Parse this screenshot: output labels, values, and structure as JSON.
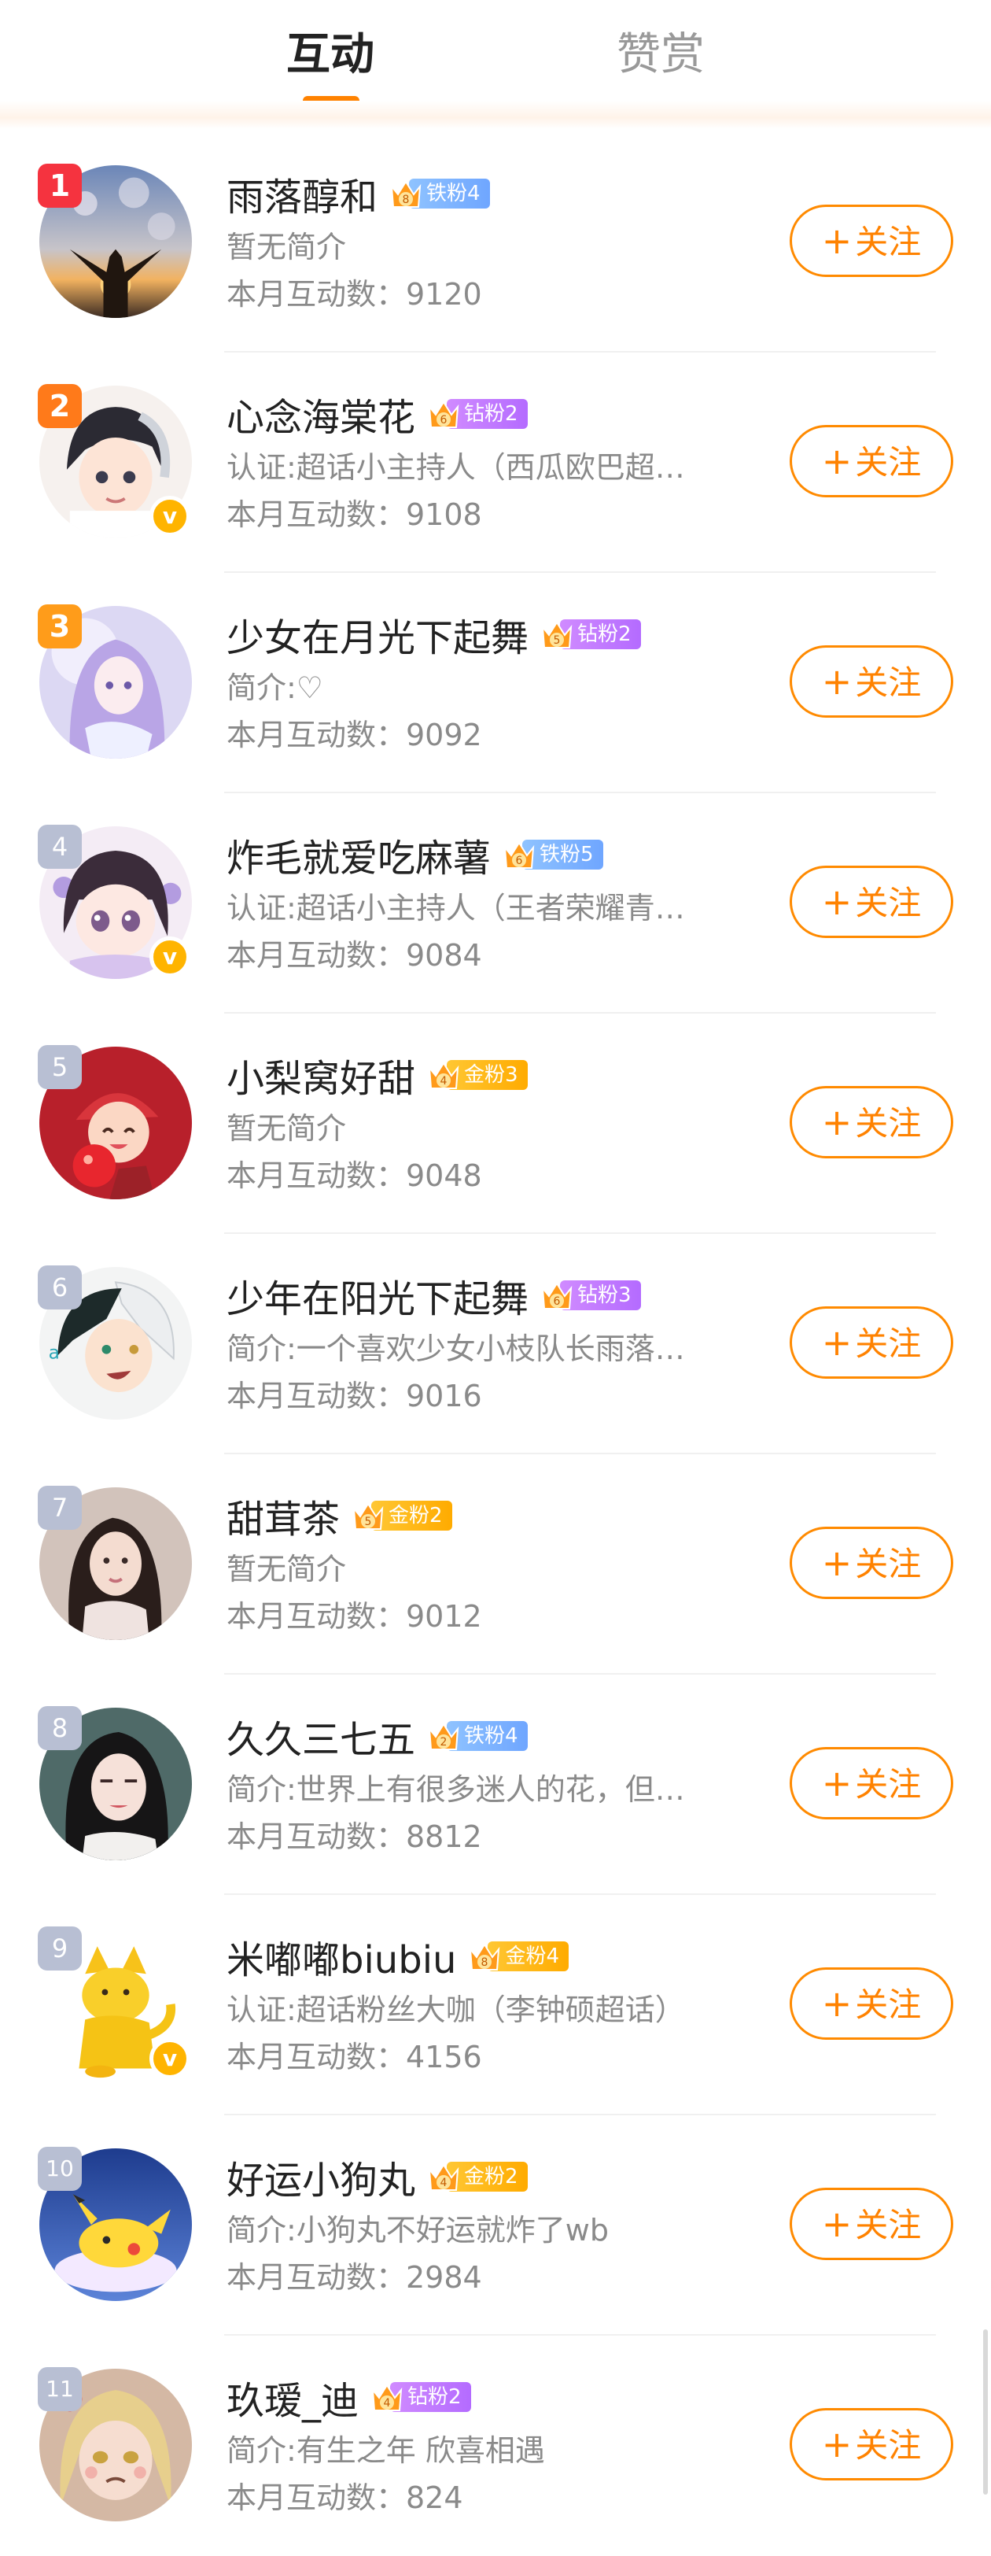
{
  "tabs": {
    "active": "互动",
    "other": "赞赏"
  },
  "colors": {
    "accent": "#ff8200",
    "iron": "#6fa6ff",
    "diamond": "#b46bff",
    "gold": "#ffab00"
  },
  "follow_label": "关注",
  "follow_icon": "plus-icon",
  "rows": [
    {
      "rank": "1",
      "name": "雨落醇和",
      "crown": "8",
      "fan_label": "铁粉4",
      "fan_type": "iron",
      "desc": "暂无简介",
      "count_label": "本月互动数：9120",
      "verified": false,
      "avatar": "sunset-person"
    },
    {
      "rank": "2",
      "name": "心念海棠花",
      "crown": "6",
      "fan_label": "钻粉2",
      "fan_type": "diamond",
      "desc": "认证:超话小主持人（西瓜欧巴超…",
      "count_label": "本月互动数：9108",
      "verified": true,
      "avatar": "anime-boy"
    },
    {
      "rank": "3",
      "name": "少女在月光下起舞",
      "crown": "5",
      "fan_label": "钻粉2",
      "fan_type": "diamond",
      "desc": "简介:♡",
      "count_label": "本月互动数：9092",
      "verified": false,
      "avatar": "anime-girl-purple"
    },
    {
      "rank": "4",
      "name": "炸毛就爱吃麻薯",
      "crown": "6",
      "fan_label": "铁粉5",
      "fan_type": "iron",
      "desc": "认证:超话小主持人（王者荣耀青…",
      "count_label": "本月互动数：9084",
      "verified": true,
      "avatar": "chibi-girl"
    },
    {
      "rank": "5",
      "name": "小梨窝好甜",
      "crown": "4",
      "fan_label": "金粉3",
      "fan_type": "gold",
      "desc": "暂无简介",
      "count_label": "本月互动数：9048",
      "verified": false,
      "avatar": "girl-red-hat"
    },
    {
      "rank": "6",
      "name": "少年在阳光下起舞",
      "crown": "6",
      "fan_label": "钻粉3",
      "fan_type": "diamond",
      "desc": "简介:一个喜欢少女小枝队长雨落…",
      "count_label": "本月互动数：9016",
      "verified": false,
      "avatar": "anime-boy-white-hair"
    },
    {
      "rank": "7",
      "name": "甜茸茶",
      "crown": "5",
      "fan_label": "金粉2",
      "fan_type": "gold",
      "desc": "暂无简介",
      "count_label": "本月互动数：9012",
      "verified": false,
      "avatar": "woman-portrait"
    },
    {
      "rank": "8",
      "name": "久久三七五",
      "crown": "2",
      "fan_label": "铁粉4",
      "fan_type": "iron",
      "desc": "简介:世界上有很多迷人的花，但…",
      "count_label": "本月互动数：8812",
      "verified": false,
      "avatar": "woman-dark-hair"
    },
    {
      "rank": "9",
      "name": "米嘟嘟biubiu",
      "crown": "8",
      "fan_label": "金粉4",
      "fan_type": "gold",
      "desc": "认证:超话粉丝大咖（李钟硕超话）",
      "count_label": "本月互动数：4156",
      "verified": true,
      "avatar": "yellow-cat"
    },
    {
      "rank": "10",
      "name": "好运小狗丸",
      "crown": "4",
      "fan_label": "金粉2",
      "fan_type": "gold",
      "desc": "简介:小狗丸不好运就炸了wb",
      "count_label": "本月互动数：2984",
      "verified": false,
      "avatar": "pikachu"
    },
    {
      "rank": "11",
      "name": "玖瑷_迪",
      "crown": "4",
      "fan_label": "钻粉2",
      "fan_type": "diamond",
      "desc": "简介:有生之年 欣喜相遇",
      "count_label": "本月互动数：824",
      "verified": false,
      "avatar": "anime-blonde-girl"
    }
  ]
}
